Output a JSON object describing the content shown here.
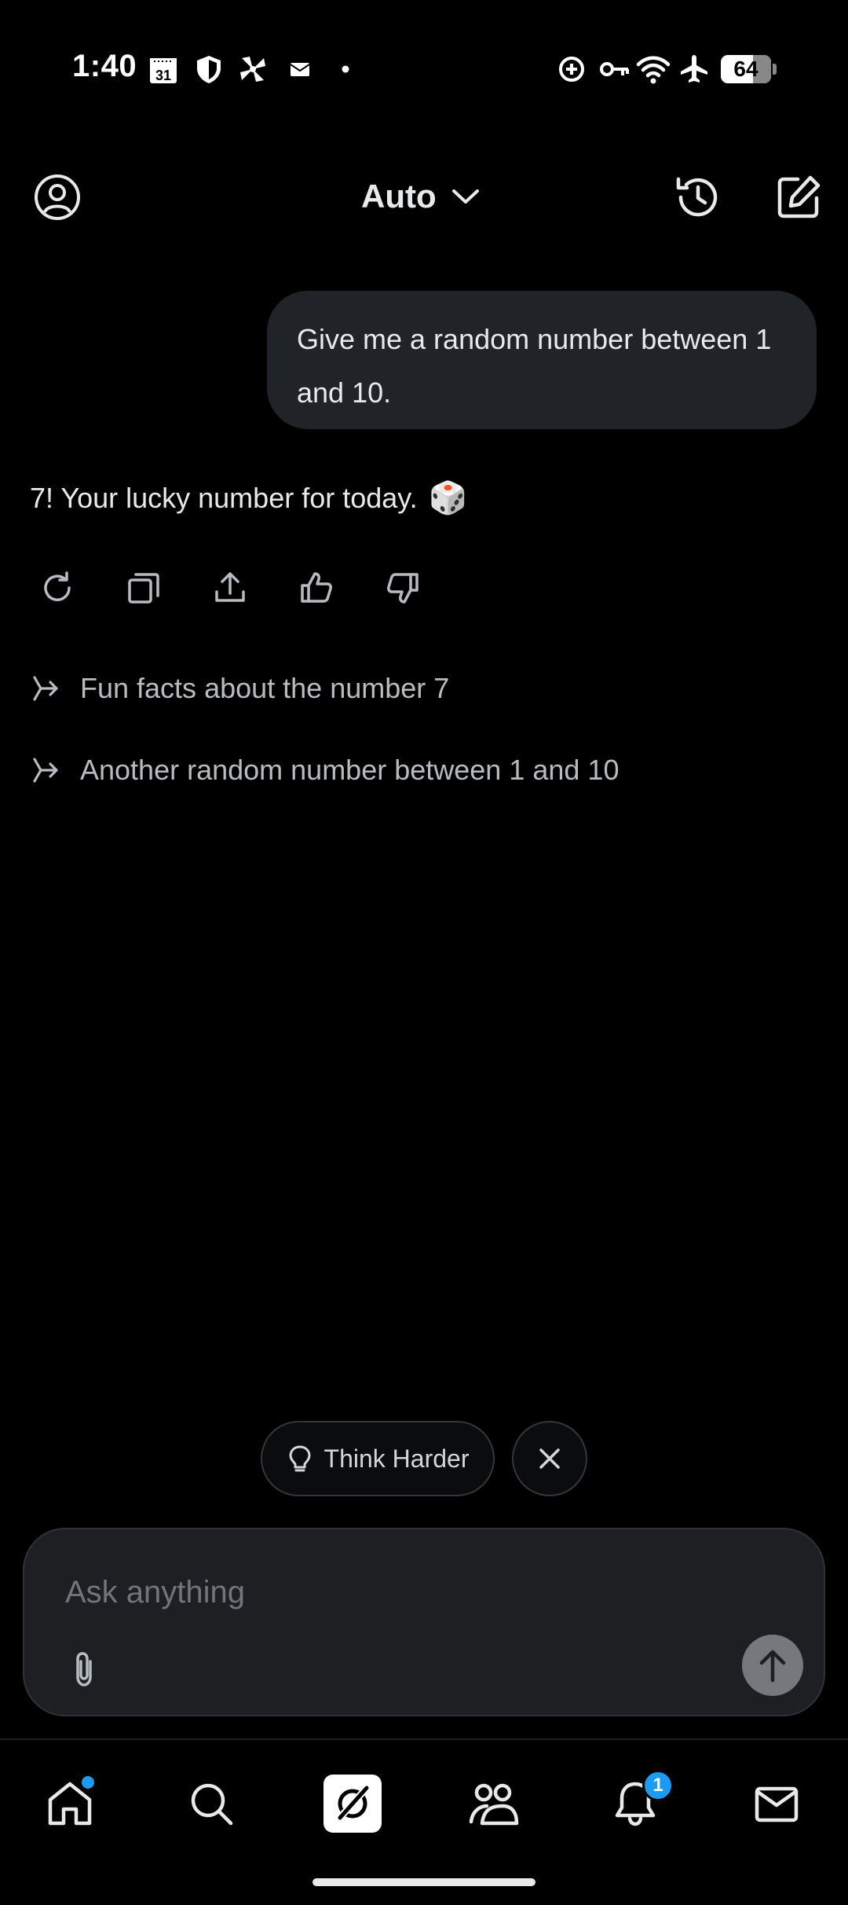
{
  "status_bar": {
    "time": "1:40",
    "calendar_day": "31",
    "battery_level": "64",
    "battery_fraction": 0.64
  },
  "header": {
    "model_label": "Auto"
  },
  "conversation": {
    "user_message": "Give me a random number between 1 and 10.",
    "assistant_reply": "7! Your lucky number for today.",
    "reply_emoji": "🎲"
  },
  "suggestions": [
    {
      "label": "Fun facts about the number 7"
    },
    {
      "label": "Another random number between 1 and 10"
    }
  ],
  "think_harder": {
    "label": "Think Harder"
  },
  "composer": {
    "placeholder": "Ask anything"
  },
  "nav": {
    "notifications_badge": "1"
  },
  "colors": {
    "background": "#000000",
    "bubble": "#202327",
    "accent": "#1d9bf0",
    "text": "#e7e9ea",
    "muted_text": "#b7bcc1"
  }
}
